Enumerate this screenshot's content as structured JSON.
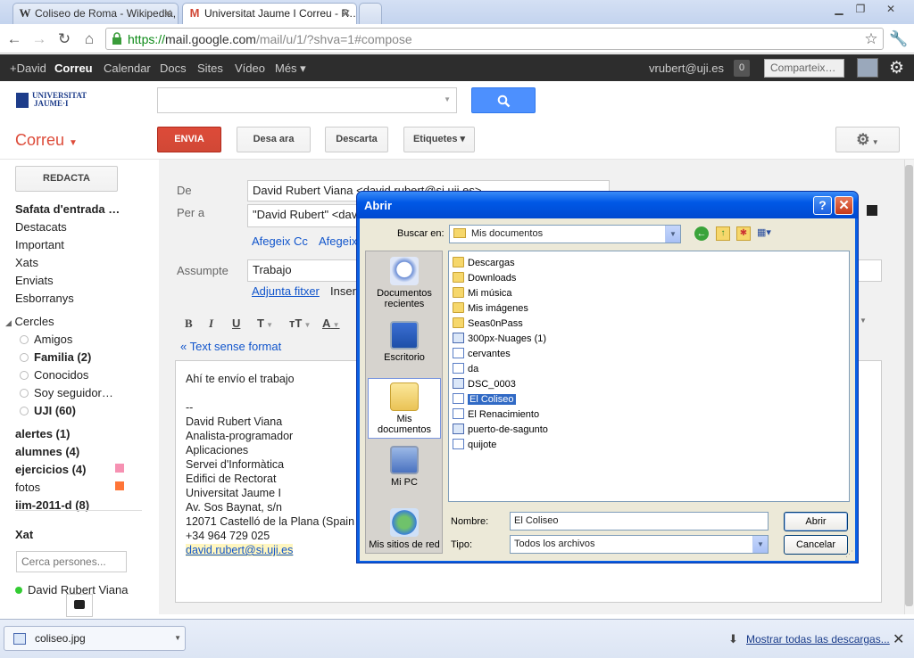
{
  "browser": {
    "tabs": [
      {
        "label": "Coliseo de Roma - Wikipedia, l…"
      },
      {
        "label": "Universitat Jaume I Correu - R…"
      }
    ],
    "url_https": "https://",
    "url_host": "mail.google.com",
    "url_path": "/mail/u/1/?shva=1#compose"
  },
  "gbar": {
    "items": [
      "+David",
      "Correu",
      "Calendar",
      "Docs",
      "Sites",
      "Vídeo",
      "Més ▾"
    ],
    "account": "vrubert@uji.es",
    "count": "0",
    "share": "Comparteix…"
  },
  "header": {
    "logo_line1": "UNIVERSITAT",
    "logo_line2": "JAUME·I"
  },
  "actions": {
    "app_label": "Correu",
    "send": "ENVIA",
    "save": "Desa ara",
    "discard": "Descarta",
    "labels": "Etiquetes ▾"
  },
  "sidebar": {
    "compose": "REDACTA",
    "items": [
      "Safata d'entrada …",
      "Destacats",
      "Important",
      "Xats",
      "Enviats",
      "Esborranys"
    ],
    "circles_title": "Cercles",
    "circles": [
      "Amigos",
      "Familia (2)",
      "Conocidos",
      "Soy seguidor…",
      "UJI (60)"
    ],
    "labels": [
      "alertes (1)",
      "alumnes (4)",
      "ejercicios (4)",
      "fotos",
      "iim-2011-d (8)"
    ],
    "label_colors": {
      "ejercicios": "#f691b2",
      "fotos": "#ff7537"
    },
    "chat_title": "Xat",
    "chat_search_placeholder": "Cerca persones...",
    "chat_contact": "David Rubert Viana"
  },
  "compose": {
    "from_label": "De",
    "from_value": "David Rubert Viana <david.rubert@si.uji.es>",
    "to_label": "Per a",
    "to_value": "\"David Rubert\" <davi",
    "add_cc": "Afegeix Cc",
    "add_bcc": "Afegeix",
    "subject_label": "Assumpte",
    "subject_value": "Trabajo",
    "attach": "Adjunta fitxer",
    "insert": "Inser",
    "plain_text": "« Text sense format",
    "body_lines": [
      "Ahí te envío el trabajo",
      "",
      "--",
      "David Rubert Viana",
      "Analista-programador",
      "Aplicaciones",
      "Servei d'Informàtica",
      "Edifici de Rectorat",
      "Universitat Jaume I",
      "Av. Sos Baynat, s/n",
      "12071 Castelló de la Plana (Spain",
      "+34 964 729 025",
      "david.rubert@si.uji.es"
    ]
  },
  "dialog": {
    "title": "Abrir",
    "look_in_label": "Buscar en:",
    "look_in_value": "Mis documentos",
    "places": [
      "Documentos recientes",
      "Escritorio",
      "Mis documentos",
      "Mi PC",
      "Mis sitios de red"
    ],
    "files": [
      {
        "name": "Descargas",
        "kind": "folder"
      },
      {
        "name": "Downloads",
        "kind": "folder"
      },
      {
        "name": "Mi música",
        "kind": "folder"
      },
      {
        "name": "Mis imágenes",
        "kind": "folder"
      },
      {
        "name": "Seas0nPass",
        "kind": "folder"
      },
      {
        "name": "300px-Nuages (1)",
        "kind": "img"
      },
      {
        "name": "cervantes",
        "kind": "doc"
      },
      {
        "name": "da",
        "kind": "doc"
      },
      {
        "name": "DSC_0003",
        "kind": "img"
      },
      {
        "name": "El Coliseo",
        "kind": "doc"
      },
      {
        "name": "El Renacimiento",
        "kind": "doc"
      },
      {
        "name": "puerto-de-sagunto",
        "kind": "img"
      },
      {
        "name": "quijote",
        "kind": "doc"
      }
    ],
    "selected_file": "El Coliseo",
    "name_label": "Nombre:",
    "name_value": "El Coliseo",
    "type_label": "Tipo:",
    "type_value": "Todos los archivos",
    "open_button": "Abrir",
    "cancel_button": "Cancelar"
  },
  "downloads": {
    "file": "coliseo.jpg",
    "show_all": "Mostrar todas las descargas..."
  }
}
